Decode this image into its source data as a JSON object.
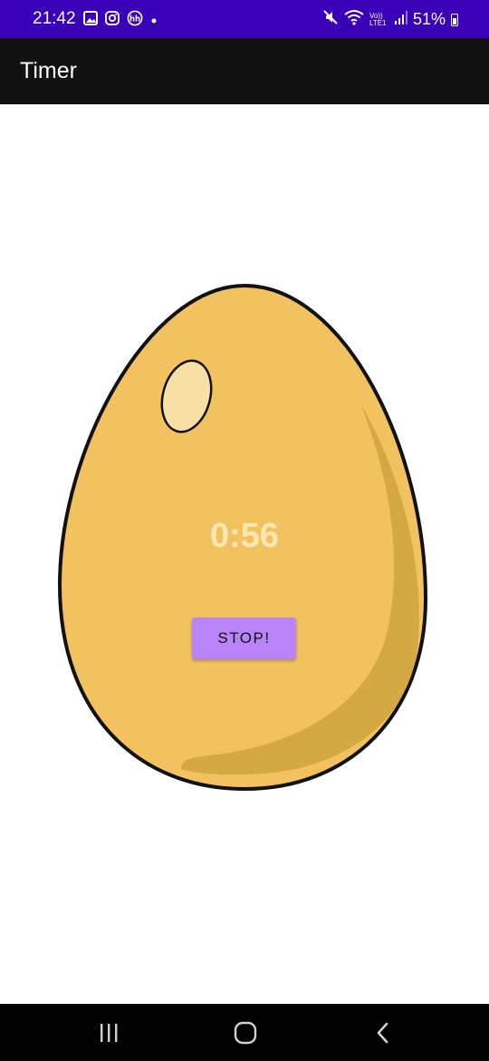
{
  "status_bar": {
    "time": "21:42",
    "battery": "51%",
    "network_label": "Vo)) LTE1",
    "background": "#3a00b8",
    "left_icons": [
      "gallery-icon",
      "instagram-icon",
      "hh-icon",
      "dot-icon"
    ],
    "right_icons": [
      "mute-icon",
      "wifi-icon",
      "signal-icon",
      "battery-icon"
    ]
  },
  "app_bar": {
    "title": "Timer",
    "background": "#121212"
  },
  "main": {
    "timer_value": "0:56",
    "stop_label": "STOP!",
    "egg_color": "#f2c260",
    "egg_shadow_color": "#d4a843",
    "egg_highlight_color": "#f8dfa6",
    "button_color": "#b884f7"
  },
  "nav_bar": {
    "items": [
      "recent-apps-icon",
      "home-icon",
      "back-icon"
    ]
  }
}
